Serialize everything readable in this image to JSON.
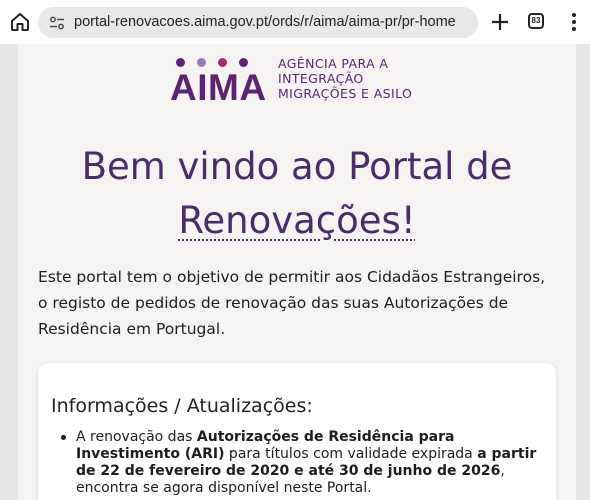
{
  "browser": {
    "url": "portal-renovacoes.aima.gov.pt/ords/r/aima/aima-pr/pr-home",
    "tab_count": "83"
  },
  "logo": {
    "word": "AIMA",
    "tagline": [
      "AGÊNCIA PARA A",
      "INTEGRAÇÃO",
      "MIGRAÇÕES E ASILO"
    ],
    "colors": {
      "purple": "#5b2372",
      "magenta": "#b0266a",
      "lavender": "#9a78b8"
    }
  },
  "hero": {
    "title_line1": "Bem vindo ao Portal de",
    "title_line2": "Renovações!"
  },
  "intro": "Este portal tem o objetivo de permitir aos Cidadãos Estrangeiros, o registo de pedidos de renovação das suas Autorizações de Residência em Portugal.",
  "updates": {
    "title": "Informações / Atualizações:",
    "items": [
      {
        "t1": "A renovação das ",
        "b1": "Autorizações de Residência para Investimento (ARI)",
        "t2": " para títulos com validade expirada ",
        "b2": "a partir de 22 de fevereiro de 2020 e até 30 de junho de 2026",
        "t3": ", encontra se agora disponível neste Portal."
      }
    ]
  }
}
